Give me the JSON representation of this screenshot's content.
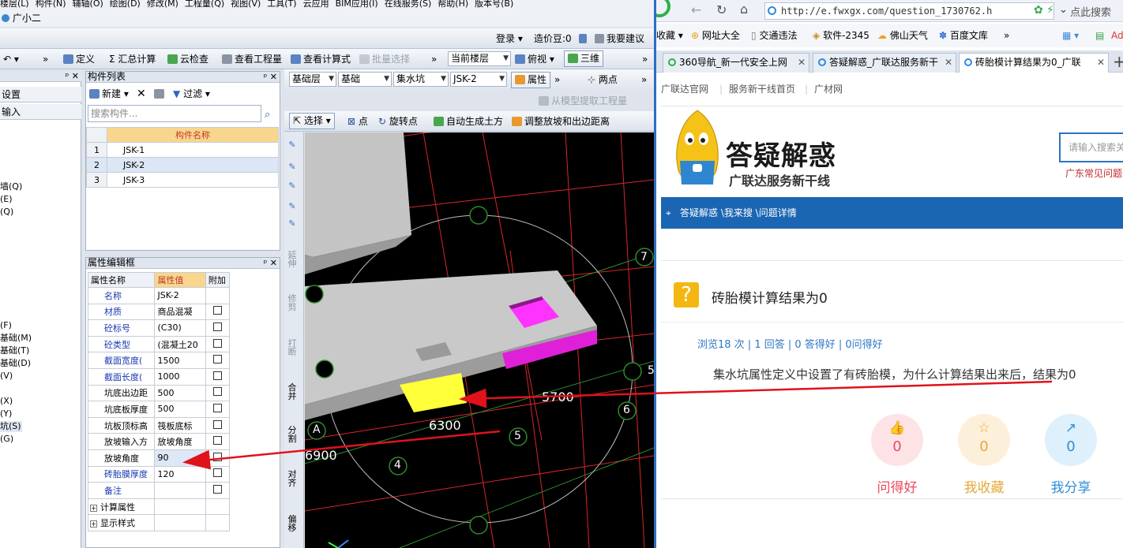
{
  "app": {
    "menubar": [
      "楼层(L)",
      "构件(N)",
      "辅轴(O)",
      "绘图(D)",
      "修改(M)",
      "工程量(Q)",
      "视图(V)",
      "工具(T)",
      "云应用",
      "BIM应用(I)",
      "在线服务(S)",
      "帮助(H)",
      "版本号(B)"
    ],
    "assistant": "广小二",
    "top_right": {
      "login": "登录",
      "price_label": "造价豆:0",
      "suggest": "我要建议"
    },
    "toolbar": {
      "define": "定义",
      "summary": "Σ 汇总计算",
      "cloud_check": "云检查",
      "view_qty": "查看工程量",
      "view_formula": "查看计算式",
      "batch_select": "批量选择",
      "current_floor": "当前楼层",
      "view_mode": "俯视",
      "three_d": "三维"
    },
    "toolbar2": {
      "floor": "基础层",
      "category": "基础",
      "type": "集水坑",
      "member": "JSK-2",
      "props": "属性",
      "two_point": "两点",
      "extract_qty": "从模型提取工程量"
    },
    "toolbar3": {
      "select": "选择",
      "point": "点",
      "rotate_point": "旋转点",
      "auto_earthwork": "自动生成土方",
      "adjust_slope": "调整放坡和出边距离"
    },
    "left_panel": {
      "rows": [
        "设置",
        "输入",
        "墙(Q)",
        "(E)",
        "(Q)",
        "(F)",
        "基础(M)",
        "基础(T)",
        "基础(D)",
        "(V)",
        "(X)",
        "(Y)",
        "坑(S)",
        "(G)"
      ],
      "selected": "坑(S)"
    },
    "component_list": {
      "title": "构件列表",
      "new_label": "新建",
      "filter_label": "过滤",
      "search_placeholder": "搜索构件...",
      "header": "构件名称",
      "rows": [
        {
          "no": "1",
          "name": "JSK-1"
        },
        {
          "no": "2",
          "name": "JSK-2"
        },
        {
          "no": "3",
          "name": "JSK-3"
        }
      ]
    },
    "property_editor": {
      "title": "属性编辑框",
      "headers": [
        "属性名称",
        "属性值",
        "附加"
      ],
      "rows": [
        {
          "name": "名称",
          "value": "JSK-2",
          "blue": true,
          "check": false
        },
        {
          "name": "材质",
          "value": "商品混凝",
          "blue": true,
          "check": true
        },
        {
          "name": "砼标号",
          "value": "(C30)",
          "blue": true,
          "check": true
        },
        {
          "name": "砼类型",
          "value": "(混凝土20",
          "blue": true,
          "check": true
        },
        {
          "name": "截面宽度(",
          "value": "1500",
          "blue": true,
          "check": true
        },
        {
          "name": "截面长度(",
          "value": "1000",
          "blue": true,
          "check": true
        },
        {
          "name": "坑底出边距",
          "value": "500",
          "blue": false,
          "check": true
        },
        {
          "name": "坑底板厚度",
          "value": "500",
          "blue": false,
          "check": true
        },
        {
          "name": "坑板顶标高",
          "value": "筏板底标",
          "blue": false,
          "check": true
        },
        {
          "name": "放坡输入方",
          "value": "放坡角度",
          "blue": false,
          "check": true
        },
        {
          "name": "放坡角度",
          "value": "90",
          "blue": false,
          "check": true
        },
        {
          "name": "砖胎膜厚度",
          "value": "120",
          "blue": true,
          "check": true
        },
        {
          "name": "备注",
          "value": "",
          "blue": true,
          "check": true
        },
        {
          "name": "计算属性",
          "value": "",
          "blue": false,
          "check": false,
          "expand": true
        },
        {
          "name": "显示样式",
          "value": "",
          "blue": false,
          "check": false,
          "expand": true
        }
      ]
    },
    "vertical_tools": [
      "延伸",
      "修剪",
      "打断",
      "合并",
      "分割",
      "对齐",
      "偏移"
    ],
    "viewport_labels": {
      "dim1": "5700",
      "dim2": "6300",
      "dim3": "6900",
      "axis4": "4",
      "axis5": "5",
      "axis6": "6",
      "axis7": "7",
      "axisA": "A",
      "axis5r": "5"
    }
  },
  "browser": {
    "url": "http://e.fwxgx.com/question_1730762.h",
    "search_label": "点此搜索",
    "bookmarks": [
      "收藏",
      "网址大全",
      "交通违法",
      "软件-2345",
      "佛山天气",
      "百度文库"
    ],
    "tabs": [
      {
        "title": "360导航_新一代安全上网",
        "active": false
      },
      {
        "title": "答疑解惑_广联达服务新干",
        "active": false
      },
      {
        "title": "砖胎模计算结果为0_广联",
        "active": true
      }
    ],
    "site_nav": [
      "广联达官网",
      "服务新干线首页",
      "广材网"
    ],
    "logo_title": "答疑解惑",
    "logo_subtitle": "广联达服务新干线",
    "search_placeholder": "请输入搜索关",
    "common_q": "广东常见问题",
    "breadcrumb": "答疑解惑 \\我来搜 \\问题详情",
    "question_title": "砖胎模计算结果为0",
    "stats": "浏览18 次 | 1 回答 | 0 答得好 | 0问得好",
    "question_body": "集水坑属性定义中设置了有砖胎模，为什么计算结果出来后，结果为0",
    "actions": [
      {
        "count": "0",
        "label": "问得好",
        "color": "#e94c5e",
        "bg": "#fde3e6"
      },
      {
        "count": "0",
        "label": "我收藏",
        "color": "#e5a93a",
        "bg": "#fdf0da"
      },
      {
        "count": "0",
        "label": "我分享",
        "color": "#2f8fd8",
        "bg": "#def0fb"
      }
    ]
  }
}
